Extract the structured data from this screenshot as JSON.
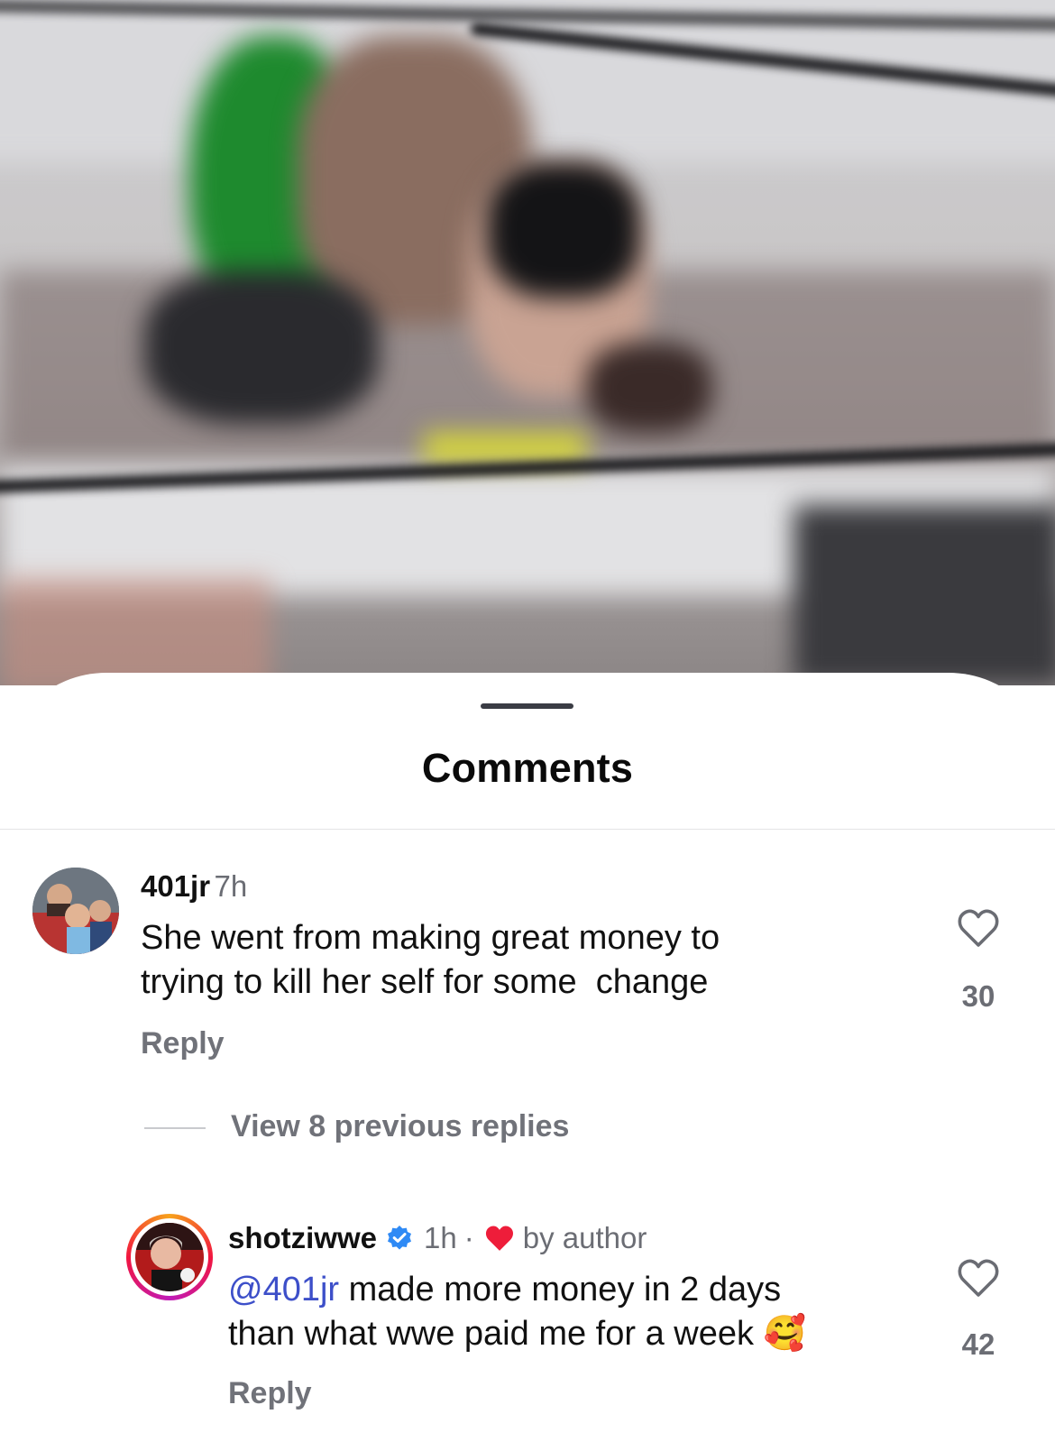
{
  "sheet": {
    "title": "Comments"
  },
  "comments": [
    {
      "username": "401jr",
      "time": "7h",
      "text_lines": [
        "She went from making great money to",
        "trying to kill her self for some  change"
      ],
      "reply_label": "Reply",
      "likes": "30",
      "view_replies_label": "View 8 previous replies"
    },
    {
      "username": "shotziwwe",
      "verified": true,
      "time": "1h",
      "separator": "·",
      "author_badge": "by author",
      "mention": "@401jr",
      "text_rest": " made more money in 2 days",
      "text_line2": "than what wwe paid me for a week",
      "emoji": "🥰",
      "reply_label": "Reply",
      "likes": "42"
    }
  ],
  "icons": {
    "like": "heart-outline-icon",
    "verified": "verified-badge-icon",
    "author_like": "heart-filled-icon"
  },
  "colors": {
    "mention": "#3d4fc9",
    "verified": "#2f8af5",
    "heart": "#ee1d3a"
  }
}
